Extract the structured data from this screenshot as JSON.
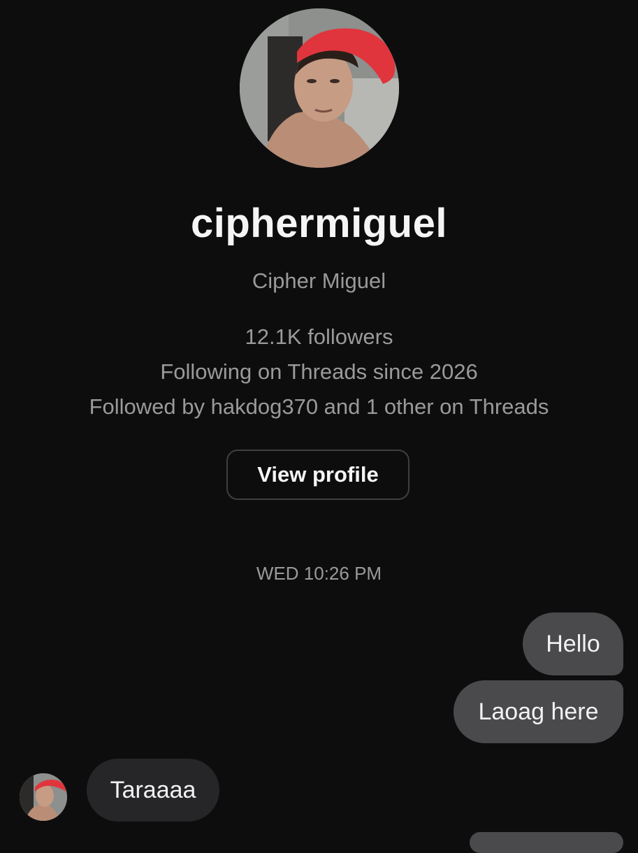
{
  "profile": {
    "username": "ciphermiguel",
    "full_name": "Cipher Miguel",
    "followers": "12.1K followers",
    "following_since": "Following on Threads since 2026",
    "followed_by": "Followed by hakdog370 and 1 other on Threads",
    "view_profile_label": "View profile"
  },
  "conversation": {
    "timestamp": "WED 10:26 PM",
    "messages": [
      {
        "direction": "outgoing",
        "text": "Hello"
      },
      {
        "direction": "outgoing",
        "text": "Laoag here"
      },
      {
        "direction": "incoming",
        "text": "Taraaaa"
      }
    ]
  },
  "colors": {
    "background": "#0d0d0e",
    "outgoing_bubble": "#4a4a4d",
    "incoming_bubble": "#262628",
    "secondary_text": "#9a9a9a",
    "cap_red": "#e0353d"
  }
}
